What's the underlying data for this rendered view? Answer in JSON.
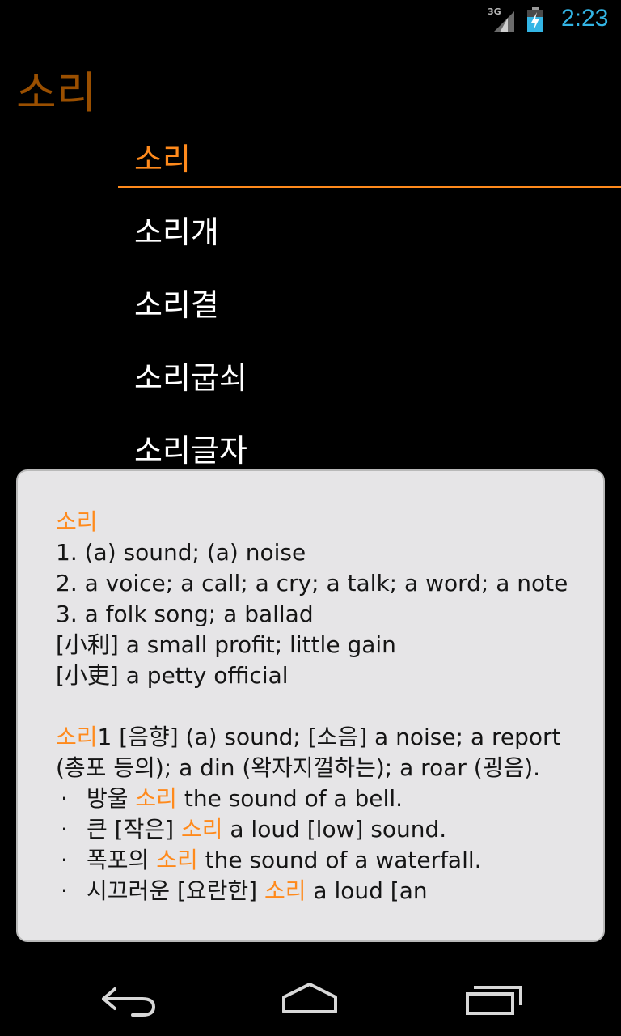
{
  "status_bar": {
    "network": "3G",
    "time": "2:23",
    "clock_color": "#33b5e5"
  },
  "search": {
    "query": "소리"
  },
  "results": [
    {
      "label": "소리",
      "selected": true
    },
    {
      "label": "소리개",
      "selected": false
    },
    {
      "label": "소리결",
      "selected": false
    },
    {
      "label": "소리굽쇠",
      "selected": false
    },
    {
      "label": "소리글자",
      "selected": false
    }
  ],
  "definition": {
    "headword": "소리",
    "senses": [
      "1. (a) sound; (a) noise",
      "2. a voice; a call; a cry; a talk; a word; a note",
      "3. a folk song; a ballad",
      "[小利] a small profit; little gain",
      "[小吏] a petty official"
    ],
    "entry2": {
      "headword": "소리",
      "number": "1",
      "text": " [음향] (a) sound; [소음] a noise; a report (총포 등의); a din (왁자지껄하는); a roar (굉음).",
      "examples": [
        {
          "dot": "·",
          "before": "방울 ",
          "highlight": "소리",
          "after": " the sound of a bell."
        },
        {
          "dot": "·",
          "before": "큰 [작은] ",
          "highlight": "소리",
          "after": " a loud [low] sound."
        },
        {
          "dot": "·",
          "before": "폭포의 ",
          "highlight": "소리",
          "after": " the sound of a waterfall."
        },
        {
          "dot": "·",
          "before": "시끄러운 [요란한] ",
          "highlight": "소리",
          "after": " a loud [an"
        }
      ]
    }
  },
  "colors": {
    "accent": "#ff8a1c",
    "title": "#9a4f00",
    "card_bg": "#e6e5e7"
  },
  "nav": {
    "back_icon": "back-arrow-icon",
    "home_icon": "home-icon",
    "recent_icon": "recent-apps-icon"
  }
}
